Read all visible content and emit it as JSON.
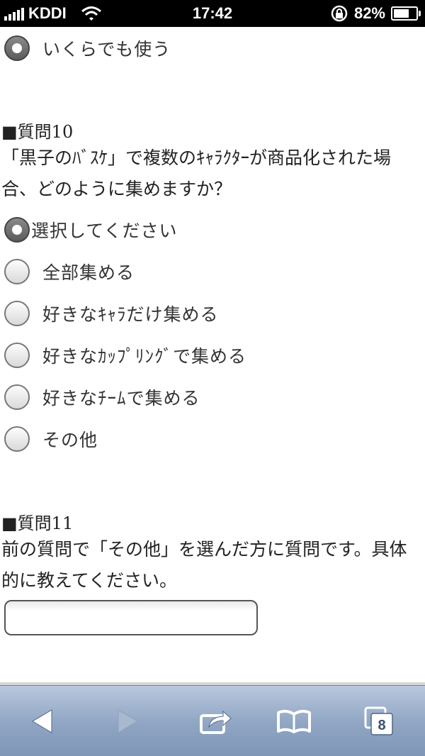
{
  "status_bar": {
    "carrier": "KDDI",
    "time": "17:42",
    "battery": "82%",
    "battery_level": 0.82
  },
  "top_option": {
    "label": "いくらでも使う",
    "selected": true
  },
  "question10": {
    "heading": "■質問10",
    "text_line1": "「黒子のﾊﾞｽｹ」で複数のｷｬﾗｸﾀｰが商品化された場",
    "text_line2": "合、どのように集めますか？",
    "options": [
      {
        "label": "選択してください",
        "selected": true
      },
      {
        "label": "全部集める",
        "selected": false
      },
      {
        "label": "好きなｷｬﾗだけ集める",
        "selected": false
      },
      {
        "label": "好きなｶｯﾌﾟﾘﾝｸﾞで集める",
        "selected": false
      },
      {
        "label": "好きなﾁｰﾑで集める",
        "selected": false
      },
      {
        "label": "その他",
        "selected": false
      }
    ]
  },
  "question11": {
    "heading": "■質問11",
    "text_line1": "前の質問で「その他」を選んだ方に質問です。具体",
    "text_line2": "的に教えてください。",
    "input_value": ""
  },
  "toolbar": {
    "back_icon": "back-arrow-icon",
    "forward_icon": "forward-arrow-icon",
    "share_icon": "share-icon",
    "bookmarks_icon": "book-icon",
    "tabs_count": "8"
  }
}
